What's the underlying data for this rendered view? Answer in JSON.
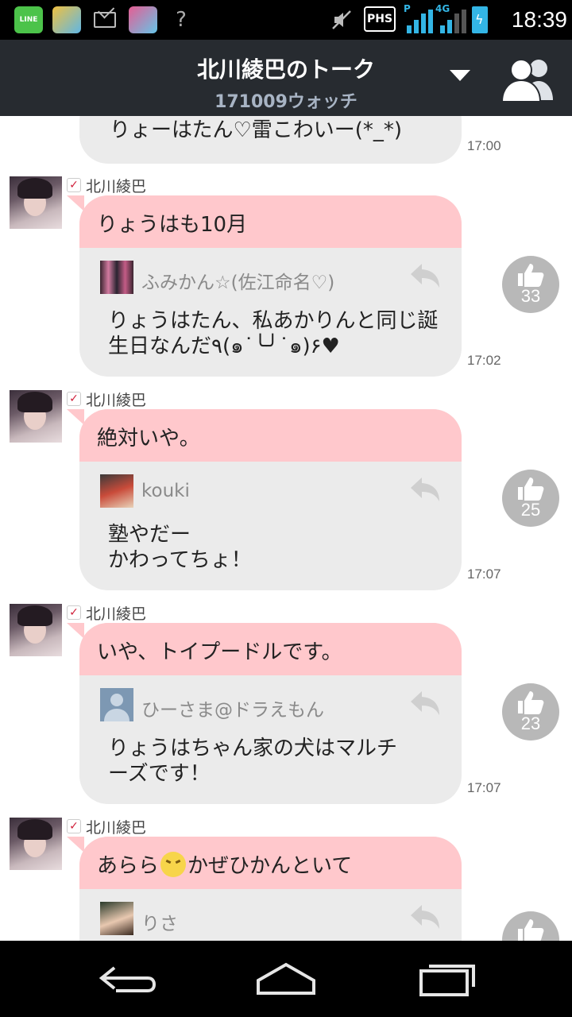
{
  "status_bar": {
    "line_icon_label": "LINE",
    "phs_label": "PHS",
    "signal_p": "P",
    "signal_4g": "4G",
    "time": "18:39",
    "icons": [
      "line-app-icon",
      "app-icon",
      "mail-icon",
      "app-icon",
      "wifi-icon",
      "mute-icon",
      "phs-icon",
      "signal-icon",
      "battery-icon"
    ]
  },
  "header": {
    "title": "北川綾巴のトーク",
    "subtitle": "171009ウォッチ"
  },
  "colors": {
    "header_bg": "#272b30",
    "bubble_head": "#ffc8cc",
    "bubble_body": "#ebebeb",
    "like_bg": "#b8b8b8",
    "verify": "#d01f3a"
  },
  "partial_message": {
    "text": "りょーはたん♡雷こわいー(*_*)",
    "time": "17:00"
  },
  "messages": [
    {
      "sender": "北川綾巴",
      "head_text": "りょうはも10月",
      "reply_name": "ふみかん☆(佐江命名♡)",
      "reply_text": "りょうはたん、私あかりんと同じ誕生日なんだ٩(๑˙╰╯˙๑)۶♥",
      "time": "17:02",
      "likes": "33"
    },
    {
      "sender": "北川綾巴",
      "head_text": "絶対いや。",
      "reply_name": "kouki",
      "reply_text": "塾やだー\nかわってちょ！",
      "time": "17:07",
      "likes": "25"
    },
    {
      "sender": "北川綾巴",
      "head_text": "いや、トイプードルです。",
      "reply_name": "ひーさま@ドラえもん",
      "reply_text": "りょうはちゃん家の犬はマルチーズです！",
      "time": "17:07",
      "likes": "23"
    },
    {
      "sender": "北川綾巴",
      "head_before": "あらら",
      "head_after": "かぜひかんといて",
      "reply_name": "りさ"
    }
  ]
}
